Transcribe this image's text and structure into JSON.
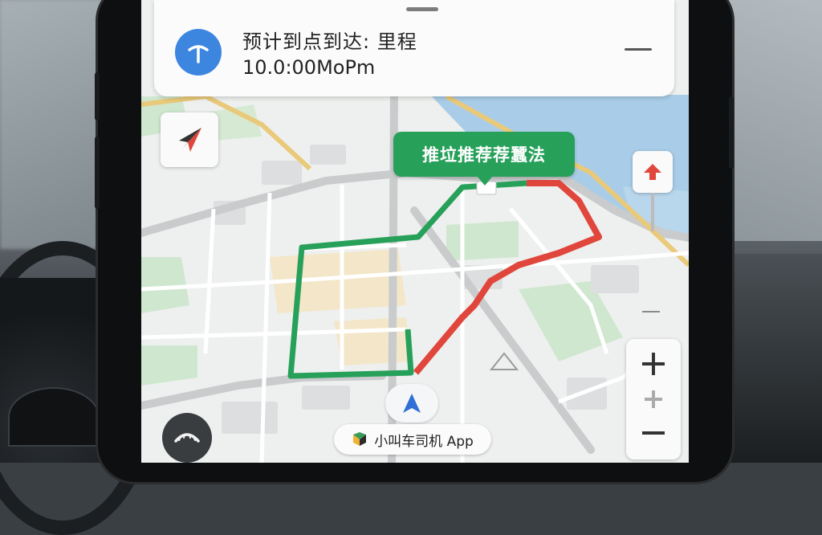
{
  "nav": {
    "eta_line1": "预计到点到达: 里程",
    "eta_line2": "10.0:00MoPm",
    "route_label": "推垃推荐荐蠶法"
  },
  "footer": {
    "app_name": "小叫车司机 App"
  },
  "icons": {
    "turn": "turn-straight-icon",
    "compass": "compass-arrow-icon",
    "report": "up-arrow-pin-icon",
    "zoom_in": "plus-icon",
    "zoom_mid": "plus-icon",
    "zoom_out": "minus-icon",
    "location": "navigation-arrow-icon",
    "app_logo": "app-logo-icon",
    "hangup": "hangup-icon"
  },
  "colors": {
    "route_green": "#27a05a",
    "route_red": "#e0463c",
    "water": "#a9cde8",
    "turn_blue": "#3d86e0"
  }
}
